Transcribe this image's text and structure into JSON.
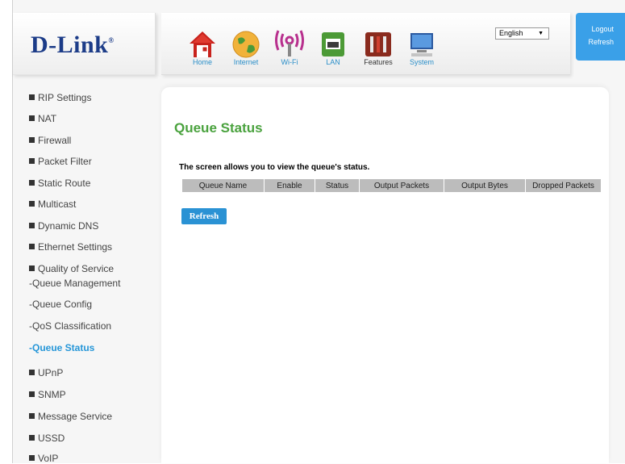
{
  "brand": {
    "logo_text": "D-Link",
    "reg_mark": "®"
  },
  "nav": [
    {
      "label": "Home",
      "icon": "home-icon"
    },
    {
      "label": "Internet",
      "icon": "globe-icon"
    },
    {
      "label": "Wi-Fi",
      "icon": "wifi-icon"
    },
    {
      "label": "LAN",
      "icon": "lan-port-icon"
    },
    {
      "label": "Features",
      "icon": "tools-icon"
    },
    {
      "label": "System",
      "icon": "computer-icon"
    }
  ],
  "language": {
    "selected": "English"
  },
  "account": {
    "logout_label": "Logout",
    "refresh_label": "Refresh"
  },
  "sidebar": {
    "items": [
      "RIP Settings",
      "NAT",
      "Firewall",
      "Packet Filter",
      "Static Route",
      "Multicast",
      "Dynamic DNS",
      "Ethernet Settings",
      "Quality of Service"
    ],
    "subitems": [
      "-Queue Management",
      "-Queue Config",
      "-QoS Classification",
      "-Queue Status"
    ],
    "items_after": [
      "UPnP",
      "SNMP",
      "Message Service",
      "USSD",
      "VoIP"
    ]
  },
  "main": {
    "title": "Queue Status",
    "description": "The screen allows you to view the queue's status.",
    "table_headers": [
      "Queue Name",
      "Enable",
      "Status",
      "Output Packets",
      "Output Bytes",
      "Dropped Packets"
    ],
    "refresh_button": "Refresh"
  },
  "colors": {
    "accent_blue": "#2a92d4",
    "title_green": "#4aa23e",
    "brand_navy": "#1c3c88"
  }
}
